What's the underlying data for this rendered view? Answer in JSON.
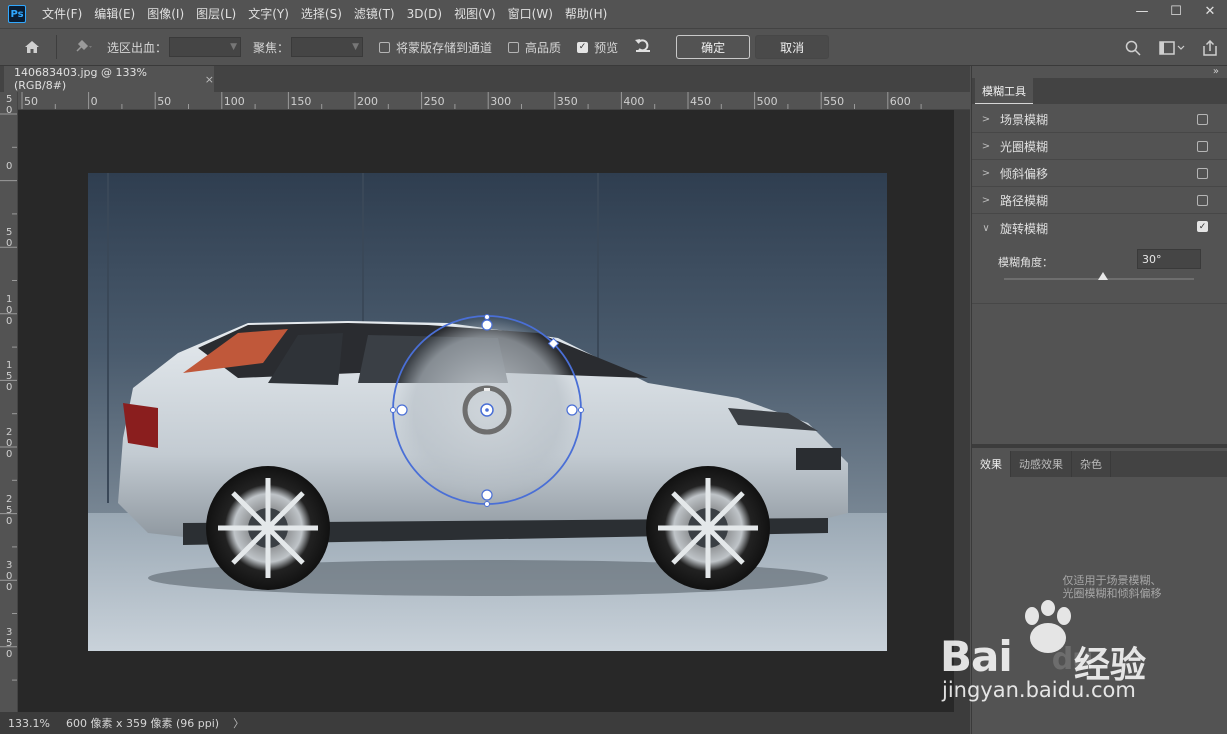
{
  "app": {
    "logo": "Ps",
    "menus": [
      "文件(F)",
      "编辑(E)",
      "图像(I)",
      "图层(L)",
      "文字(Y)",
      "选择(S)",
      "滤镜(T)",
      "3D(D)",
      "视图(V)",
      "窗口(W)",
      "帮助(H)"
    ],
    "window_controls": [
      "—",
      "☐",
      "✕"
    ]
  },
  "options": {
    "selection_bleed_label": "选区出血：",
    "focus_label": "聚焦：",
    "save_mask_label": "将蒙版存储到通道",
    "save_mask_checked": false,
    "high_quality_label": "高品质",
    "high_quality_checked": false,
    "preview_label": "预览",
    "preview_checked": true,
    "ok_label": "确定",
    "cancel_label": "取消"
  },
  "document": {
    "tab_title": "140683403.jpg @ 133%(RGB/8#)",
    "close_glyph": "×"
  },
  "ruler": {
    "top_labels": [
      "50",
      "0",
      "50",
      "100",
      "150",
      "200",
      "250",
      "300",
      "350",
      "400",
      "450",
      "500",
      "550",
      "600"
    ],
    "left_labels": [
      "50",
      "0",
      "50",
      "100",
      "150",
      "200",
      "250",
      "300",
      "350"
    ]
  },
  "status": {
    "zoom": "133.1%",
    "doc_info": "600 像素 x 359 像素 (96 ppi)",
    "arrow": "〉"
  },
  "panel": {
    "collapse_glyph": "»",
    "title": "模糊工具",
    "blur_items": [
      {
        "label": "场景模糊",
        "checked": false
      },
      {
        "label": "光圈模糊",
        "checked": false
      },
      {
        "label": "倾斜偏移",
        "checked": false
      },
      {
        "label": "路径模糊",
        "checked": false
      }
    ],
    "spin_blur": {
      "label": "旋转模糊",
      "checked": true,
      "angle_label": "模糊角度：",
      "angle_value": "30°",
      "slider_fraction": 0.52
    },
    "fx_tabs": [
      "效果",
      "动感效果",
      "杂色"
    ],
    "fx_note_line1": "仅适用于场景模糊、",
    "fx_note_line2": "光圈模糊和倾斜偏移"
  },
  "watermark": {
    "brand": "Bai",
    "brand2": "du",
    "cn": "经验",
    "url": "jingyan.baidu.com"
  }
}
